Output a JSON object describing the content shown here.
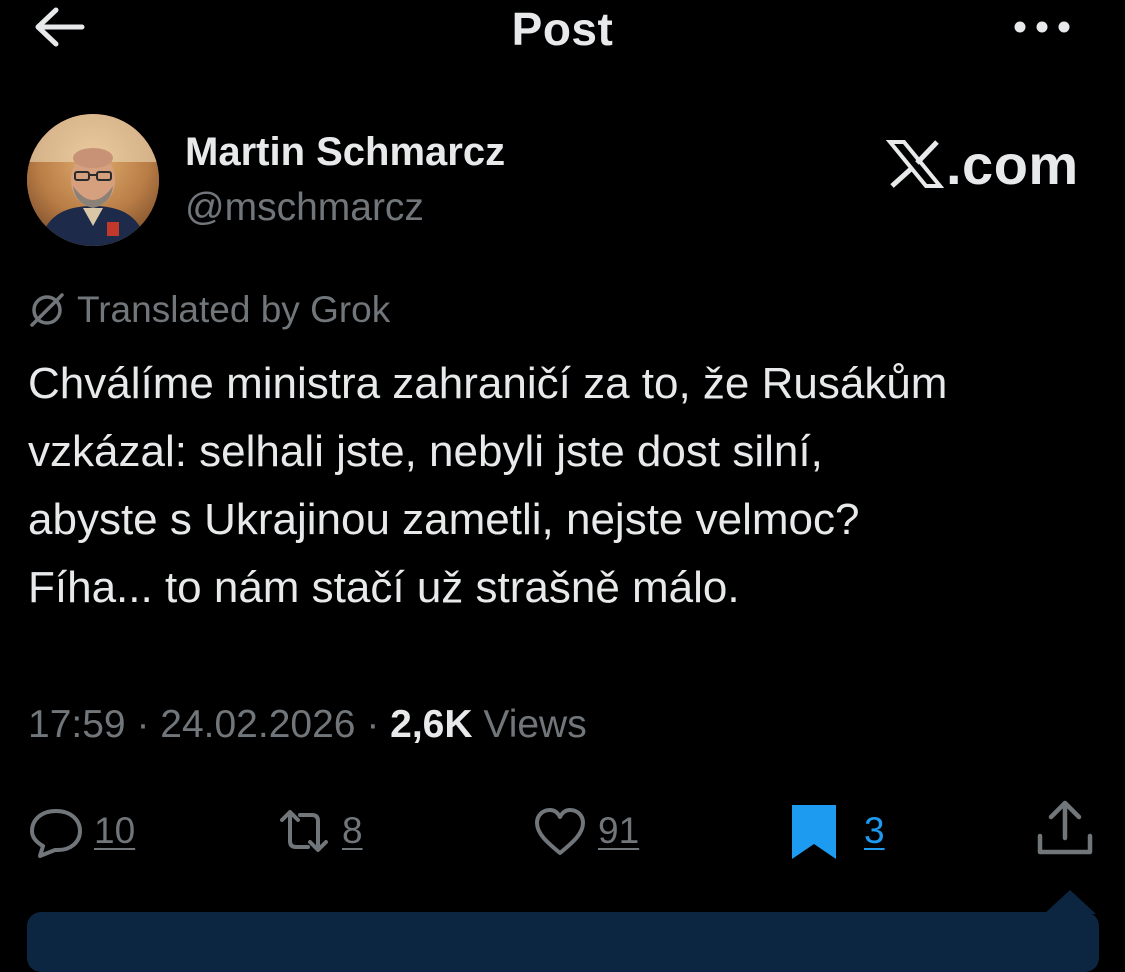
{
  "header": {
    "title": "Post",
    "back_icon": "arrow-left-icon",
    "more_icon": "ellipsis-icon"
  },
  "author": {
    "name": "Martin Schmarcz",
    "handle": "@mschmarcz"
  },
  "brand": {
    "text": ".com",
    "icon": "x-logo-icon"
  },
  "translation": {
    "label": "Translated by Grok",
    "icon": "grok-icon"
  },
  "post": {
    "lines": [
      "Chválíme ministra zahraničí za to, že Rusákům",
      "vzkázal: selhali jste, nebyli jste dost silní,",
      "abyste s Ukrajinou zametli, nejste velmoc?",
      "Fíha... to nám stačí už strašně málo."
    ]
  },
  "meta": {
    "time": "17:59",
    "separator": " · ",
    "date": "24.02.2026",
    "views_count": "2,6K",
    "views_label": " Views"
  },
  "actions": {
    "replies": "10",
    "reposts": "8",
    "likes": "91",
    "bookmarks": "3"
  },
  "colors": {
    "background": "#000000",
    "text_primary": "#e7e9ea",
    "text_secondary": "#71767b",
    "accent": "#1d9bf0",
    "banner": "#0c2540"
  }
}
